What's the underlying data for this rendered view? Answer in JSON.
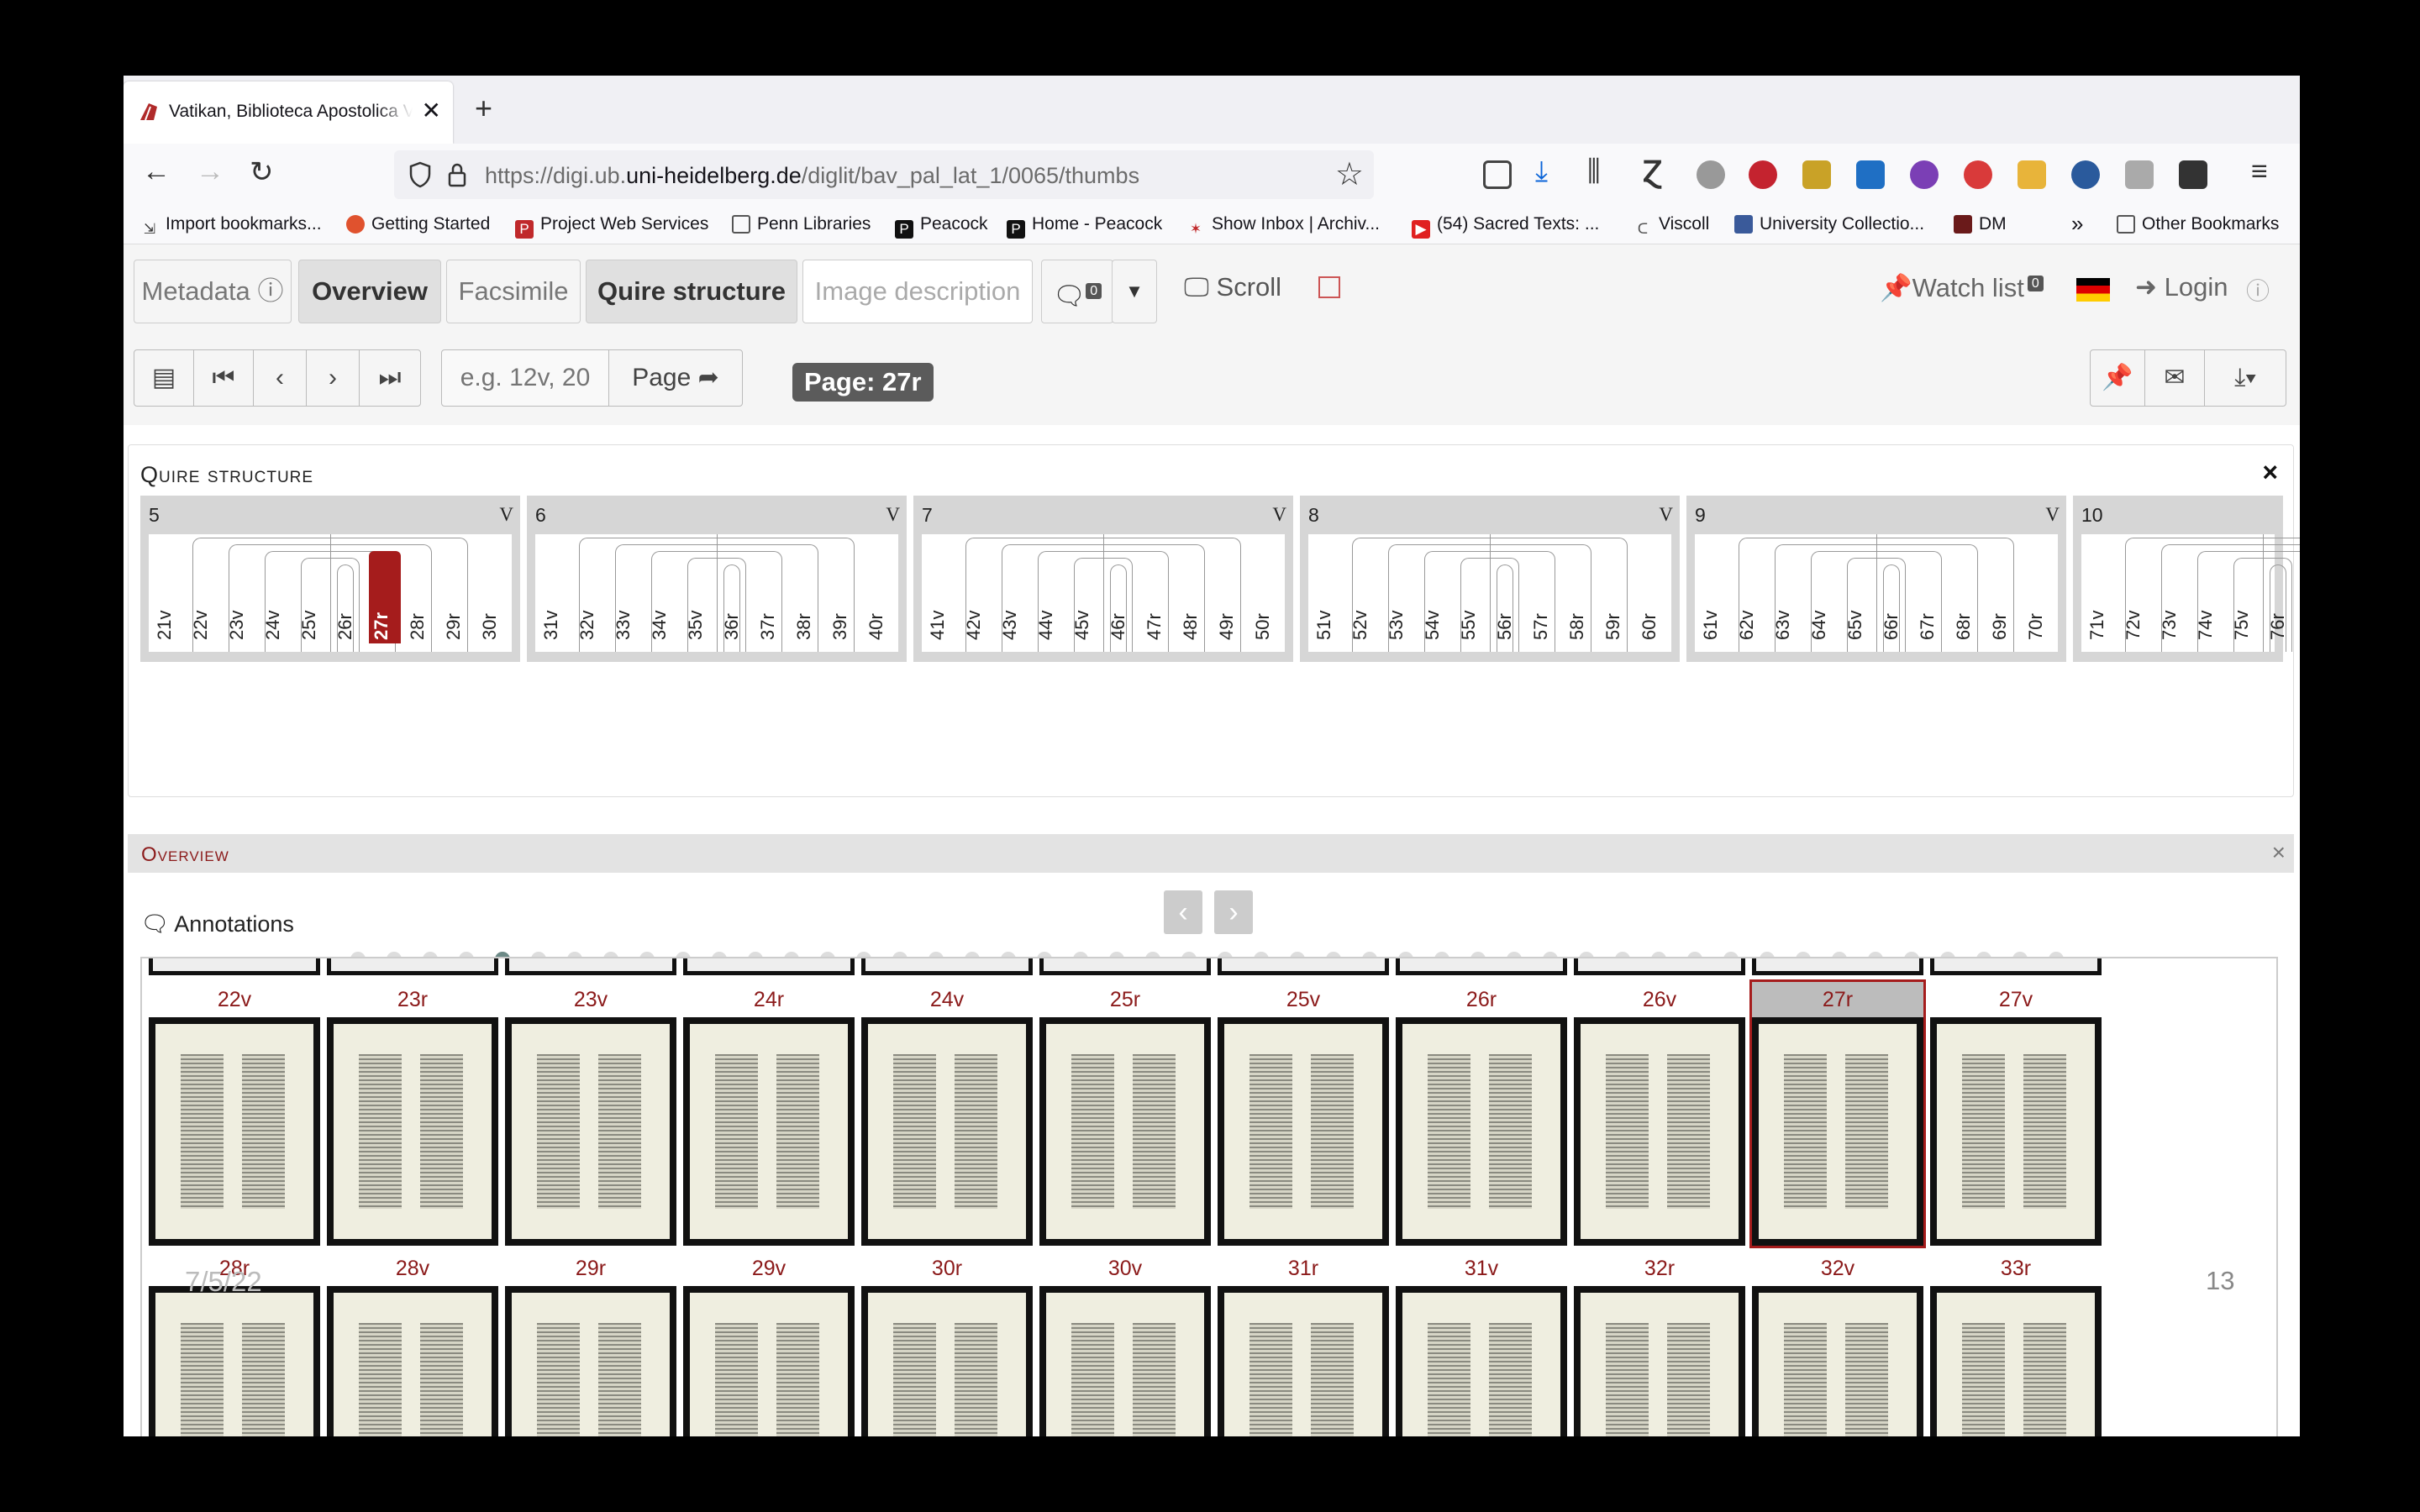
{
  "browser": {
    "tab_title": "Vatikan, Biblioteca Apostolica Va",
    "url_host_prefix": "https://digi.ub.",
    "url_host": "uni-heidelberg.de",
    "url_path": "/diglit/bav_pal_lat_1/0065/thumbs",
    "bookmarks": [
      "Import bookmarks...",
      "Getting Started",
      "Project Web Services",
      "Penn Libraries",
      "Peacock",
      "Home - Peacock",
      "Show Inbox | Archiv...",
      "(54) Sacred Texts: ...",
      "Viscoll",
      "University Collectio...",
      "DM",
      "Other Bookmarks"
    ]
  },
  "toolbar": {
    "metadata": "Metadata",
    "overview": "Overview",
    "facsimile": "Facsimile",
    "quire_structure": "Quire structure",
    "image_description": "Image description",
    "comments_count": "0",
    "scroll": "Scroll",
    "watch_list": "Watch list",
    "watch_count": "0",
    "login": "Login"
  },
  "pager": {
    "input_placeholder": "e.g. 12v, 20",
    "page_button": "Page",
    "current_page": "Page: 27r"
  },
  "quire": {
    "title": "Quire structure",
    "close": "×",
    "quires": [
      {
        "num": "5",
        "type": "V",
        "leaves": [
          "21v",
          "22v",
          "23v",
          "24v",
          "25v",
          "26r",
          "27r",
          "28r",
          "29r",
          "30r"
        ],
        "selected": 6
      },
      {
        "num": "6",
        "type": "V",
        "leaves": [
          "31v",
          "32v",
          "33v",
          "34v",
          "35v",
          "36r",
          "37r",
          "38r",
          "39r",
          "40r"
        ],
        "selected": -1
      },
      {
        "num": "7",
        "type": "V",
        "leaves": [
          "41v",
          "42v",
          "43v",
          "44v",
          "45v",
          "46r",
          "47r",
          "48r",
          "49r",
          "50r"
        ],
        "selected": -1
      },
      {
        "num": "8",
        "type": "V",
        "leaves": [
          "51v",
          "52v",
          "53v",
          "54v",
          "55v",
          "56r",
          "57r",
          "58r",
          "59r",
          "60r"
        ],
        "selected": -1
      },
      {
        "num": "9",
        "type": "V",
        "leaves": [
          "61v",
          "62v",
          "63v",
          "64v",
          "65v",
          "66r",
          "67r",
          "68r",
          "69r",
          "70r"
        ],
        "selected": -1
      },
      {
        "num": "10",
        "type": "",
        "leaves": [
          "71v",
          "72v",
          "73v",
          "74v",
          "75v",
          "76r"
        ],
        "selected": -1
      }
    ],
    "dot_count": 48,
    "active_dot": 4
  },
  "overview": {
    "title": "Overview",
    "close": "×",
    "annotations": "Annotations",
    "row1": [
      "22v",
      "23r",
      "23v",
      "24r",
      "24v",
      "25r",
      "25v",
      "26r",
      "26v",
      "27r",
      "27v"
    ],
    "row2": [
      "28r",
      "28v",
      "29r",
      "29v",
      "30r",
      "30v",
      "31r",
      "31v",
      "32r",
      "32v",
      "33r"
    ],
    "selected": "27r"
  },
  "footer": {
    "date": "7/5/22",
    "slide_number": "13"
  },
  "colors": {
    "accent": "#a51c1c",
    "label": "#8b1a1a"
  }
}
